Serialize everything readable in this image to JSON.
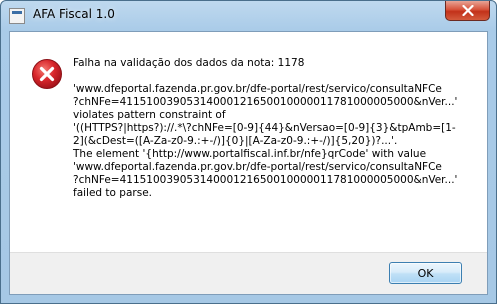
{
  "window": {
    "title": "AFA Fiscal 1.0",
    "close_icon": "close-icon"
  },
  "dialog": {
    "icon": "error-icon",
    "headline": "Falha na validação dos dados da nota: 1178",
    "message_lines": [
      "'www.dfeportal.fazenda.pr.gov.br/dfe-portal/rest/servico/consultaNFCe",
      "?chNFe=41151003905314000121650010000011781000005000&nVer...'",
      "violates pattern constraint of",
      "'((HTTPS?|https?)://.*\\?chNFe=[0-9]{44}&nVersao=[0-9]{3}&tpAmb=[1-",
      "2](&cDest=([A-Za-z0-9.:+-/)]{0}|[A-Za-z0-9.:+-/)]{5,20})?...'.",
      "The element '{http://www.portalfiscal.inf.br/nfe}qrCode' with value",
      "'www.dfeportal.fazenda.pr.gov.br/dfe-portal/rest/servico/consultaNFCe",
      "?chNFe=41151003905314000121650010000011781000005000&nVer...'",
      "failed to parse."
    ],
    "ok_label": "OK"
  },
  "colors": {
    "title_bar": "#a9cbe8",
    "close_button": "#c2311a",
    "error_icon": "#d8262b",
    "footer": "#f0f0f0"
  }
}
